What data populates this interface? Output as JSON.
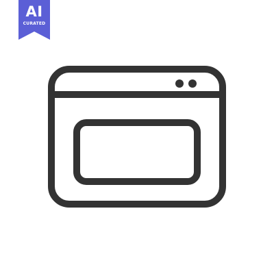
{
  "badge": {
    "title": "AI",
    "subtitle": "CURATED",
    "color": "#5b5fd6"
  },
  "icon": {
    "name": "browser-window-icon",
    "stroke_color": "#333333"
  }
}
